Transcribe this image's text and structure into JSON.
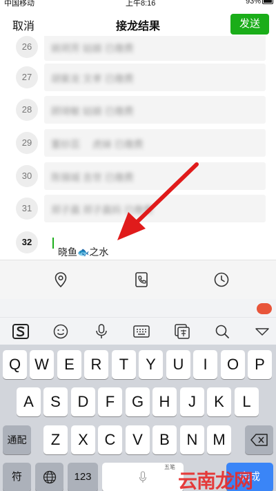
{
  "status_bar": {
    "carrier": "中国移动",
    "time": "上午8:16",
    "battery": "93%"
  },
  "header": {
    "cancel_label": "取消",
    "title": "接龙结果",
    "send_label": "发送"
  },
  "entries": [
    {
      "number": "26",
      "text": "姚玥芳 姑娘 已缴费"
    },
    {
      "number": "27",
      "text": "胡紫龙 文孝 已缴费"
    },
    {
      "number": "28",
      "text": "顾琦敏 姑娘 已缴费"
    },
    {
      "number": "29",
      "text": "董妙蕊 　虎妹 已缴费"
    },
    {
      "number": "30",
      "text": "陈锦城 吉世 已缴费"
    },
    {
      "number": "31",
      "text": "郑子晨 郑子晨妈 已缴费"
    },
    {
      "number": "32",
      "text": "晓鱼🐟之水"
    }
  ],
  "toolbar": {
    "icons": [
      "location-icon",
      "phone-icon",
      "clock-icon"
    ]
  },
  "ime": {
    "icons": [
      "sogou-logo",
      "emoji-icon",
      "microphone-icon",
      "keyboard-icon",
      "translate-icon",
      "search-icon",
      "collapse-icon"
    ]
  },
  "keyboard": {
    "row1": [
      "Q",
      "W",
      "E",
      "R",
      "T",
      "Y",
      "U",
      "I",
      "O",
      "P"
    ],
    "row2": [
      "A",
      "S",
      "D",
      "F",
      "G",
      "H",
      "J",
      "K",
      "L"
    ],
    "row3": [
      "Z",
      "X",
      "C",
      "V",
      "B",
      "N",
      "M"
    ],
    "shift_label": "通配",
    "symbol_label": "符",
    "numbers_label": "123",
    "space_hint": "五笔",
    "done_label": "完成"
  },
  "watermark": "云南龙网",
  "colors": {
    "accent_green": "#1aad19",
    "arrow_red": "#e01b1b",
    "done_blue": "#3a85f7"
  }
}
